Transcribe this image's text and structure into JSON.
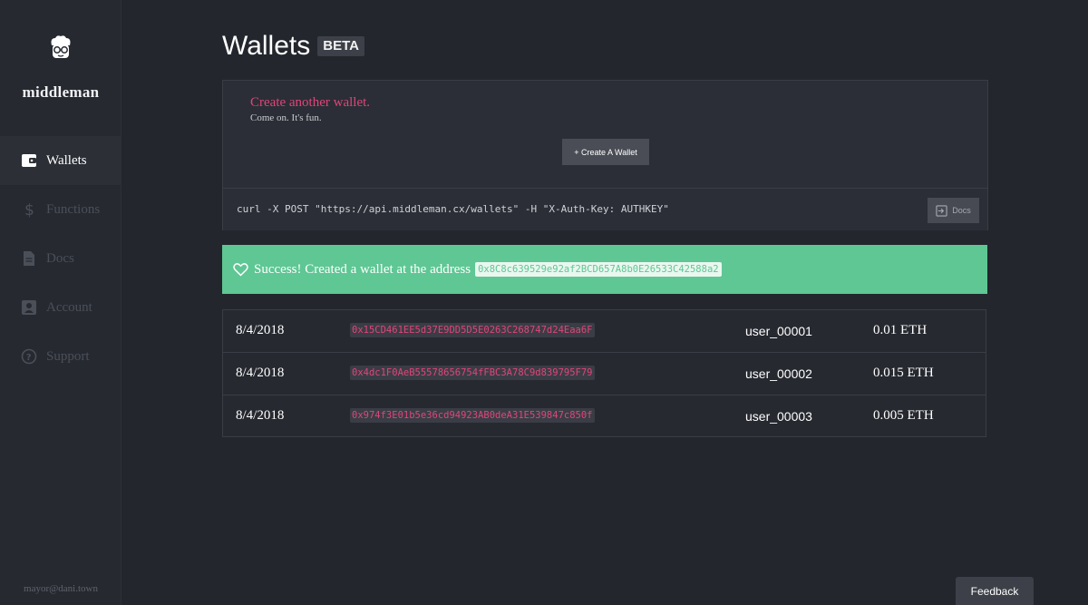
{
  "sidebar": {
    "brand": "middleman",
    "nav": [
      {
        "label": "Wallets",
        "icon": "wallet-icon",
        "active": true
      },
      {
        "label": "Functions",
        "icon": "dollar-icon",
        "active": false
      },
      {
        "label": "Docs",
        "icon": "document-icon",
        "active": false
      },
      {
        "label": "Account",
        "icon": "account-icon",
        "active": false
      },
      {
        "label": "Support",
        "icon": "help-icon",
        "active": false
      }
    ],
    "user_email": "mayor@dani.town"
  },
  "page": {
    "title": "Wallets",
    "badge": "BETA"
  },
  "create_card": {
    "title": "Create another wallet.",
    "subtitle": "Come on. It's fun.",
    "button_label": "+ Create A Wallet",
    "curl_command": "curl -X POST \"https://api.middleman.cx/wallets\" -H \"X-Auth-Key: AUTHKEY\"",
    "docs_label": "Docs"
  },
  "success": {
    "message": "Success! Created a wallet at the address",
    "address": "0x8C8c639529e92af2BCD657A8b0E26533C42588a2"
  },
  "wallets": [
    {
      "date": "8/4/2018",
      "address": "0x15CD461EE5d37E9DD5D5E0263C268747d24Eaa6F",
      "user": "user_00001",
      "amount": "0.01 ETH"
    },
    {
      "date": "8/4/2018",
      "address": "0x4dc1F0AeB55578656754fFBC3A78C9d839795F79",
      "user": "user_00002",
      "amount": "0.015 ETH"
    },
    {
      "date": "8/4/2018",
      "address": "0x974f3E01b5e36cd94923AB0deA31E539847c850f",
      "user": "user_00003",
      "amount": "0.005 ETH"
    }
  ],
  "feedback_label": "Feedback",
  "colors": {
    "accent_pink": "#e0457b",
    "success_green": "#5ec794",
    "background": "#23262d"
  }
}
